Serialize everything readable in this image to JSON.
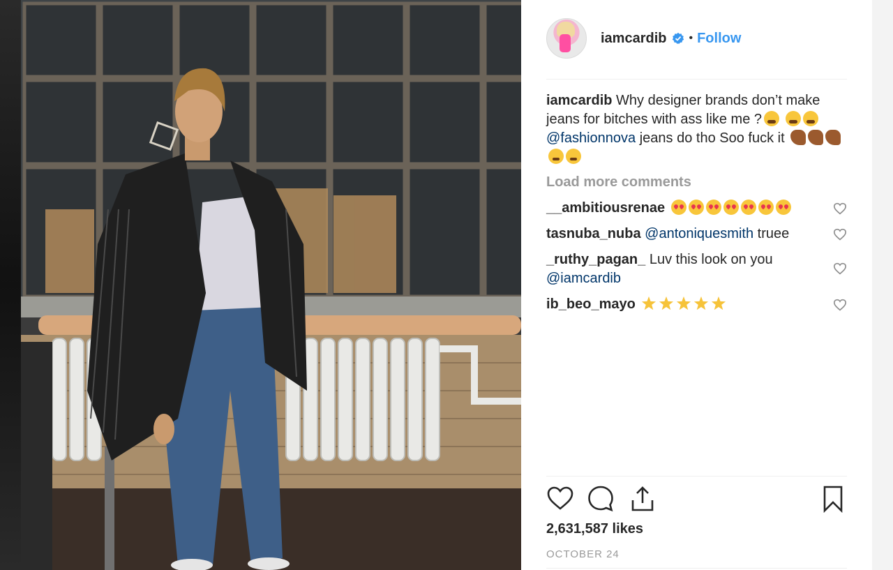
{
  "post": {
    "username": "iamcardib",
    "verified": true,
    "separator": "•",
    "follow_label": "Follow",
    "caption": {
      "author": "iamcardib",
      "text_before_mention": "Why designer brands don’t make jeans for bitches with ass like me ?",
      "mention": "@fashionnova",
      "text_after_mention": "jeans do tho Soo fuck it",
      "emojis": [
        "weary-face",
        "weary-face",
        "weary-face",
        "flexed-biceps",
        "flexed-biceps",
        "flexed-biceps",
        "triumph-face",
        "triumph-face"
      ]
    },
    "load_more_label": "Load more comments",
    "comments": [
      {
        "user": "__ambitiousrenae",
        "text": "",
        "mention": "",
        "emojis": [
          "heart-eyes",
          "heart-eyes",
          "heart-eyes",
          "heart-eyes",
          "heart-eyes",
          "heart-eyes",
          "heart-eyes"
        ]
      },
      {
        "user": "tasnuba_nuba",
        "text": "truee",
        "mention": "@antoniquesmith",
        "emojis": []
      },
      {
        "user": "_ruthy_pagan_",
        "text": "Luv this look on you",
        "mention": "@iamcardib",
        "emojis": []
      },
      {
        "user": "ib_beo_mayo",
        "text": "",
        "mention": "",
        "emojis": [
          "star",
          "star",
          "star",
          "star",
          "star"
        ]
      }
    ],
    "likes": "2,631,587 likes",
    "date": "OCTOBER 24"
  },
  "icons": {
    "like": "heart-icon",
    "comment": "comment-icon",
    "share": "share-icon",
    "save": "bookmark-icon",
    "verified": "verified-badge-icon",
    "comment_like": "heart-outline-icon"
  },
  "colors": {
    "link_blue": "#3897f0",
    "mention_blue": "#003569",
    "text": "#262626",
    "muted": "#999999",
    "verified_blue": "#3897f0"
  }
}
